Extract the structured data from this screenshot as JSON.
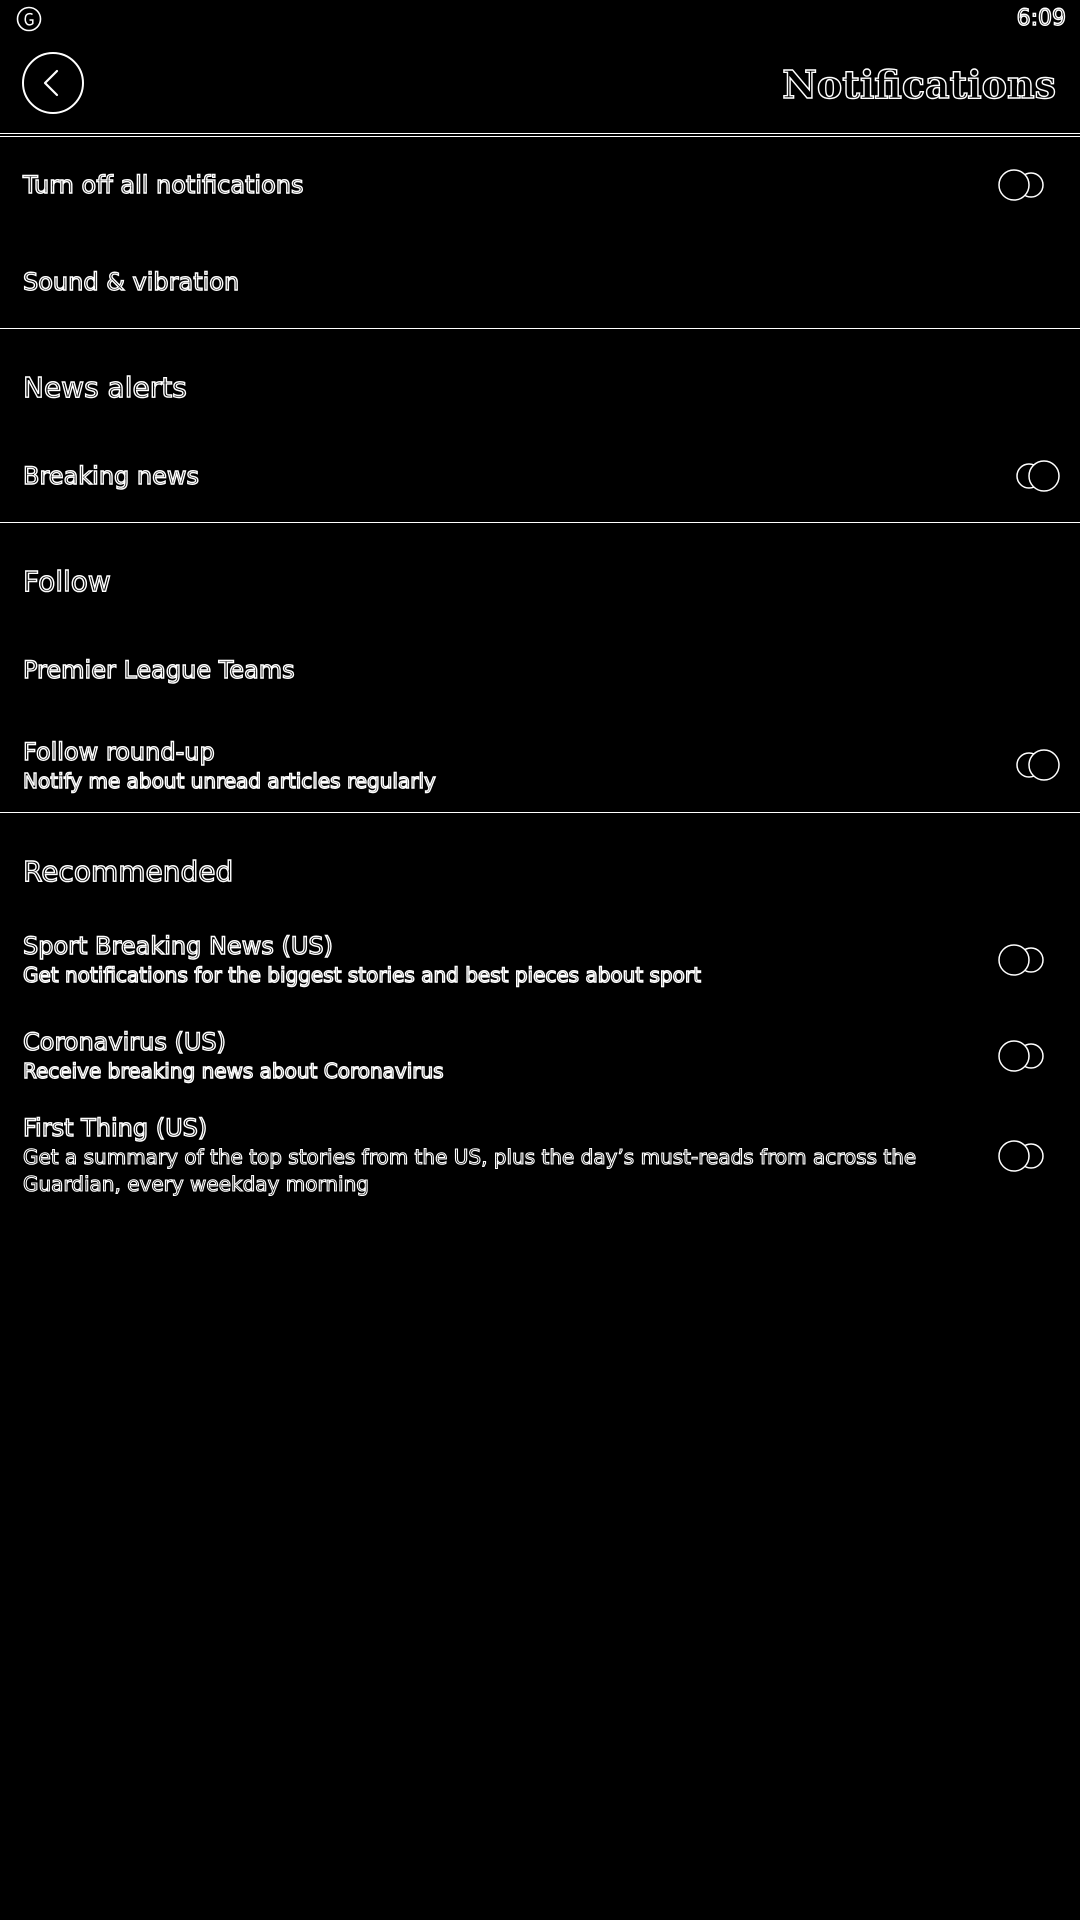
{
  "status_bar": {
    "time": "6:09",
    "app_icon": "guardian-logo-icon"
  },
  "header": {
    "title": "Notifications",
    "back_icon": "chevron-left-icon"
  },
  "general": {
    "turn_off_all": {
      "label": "Turn off all notifications",
      "toggle_on": false
    },
    "sound_vibration": {
      "label": "Sound & vibration"
    }
  },
  "news_alerts": {
    "title": "News alerts",
    "breaking_news": {
      "label": "Breaking news",
      "toggle_on": true
    }
  },
  "follow": {
    "title": "Follow",
    "premier_league": {
      "label": "Premier League Teams"
    },
    "round_up": {
      "label": "Follow round-up",
      "description": "Notify me about unread articles regularly",
      "toggle_on": true
    }
  },
  "recommended": {
    "title": "Recommended",
    "items": [
      {
        "label": "Sport Breaking News (US)",
        "description": "Get notifications for the biggest stories and best pieces about sport",
        "toggle_on": false
      },
      {
        "label": "Coronavirus (US)",
        "description": "Receive breaking news about Coronavirus",
        "toggle_on": false
      },
      {
        "label": "First Thing (US)",
        "description": "Get a summary of the top stories from the US, plus the day’s must-reads from across the Guardian, every weekday morning",
        "toggle_on": false
      }
    ]
  },
  "colors": {
    "background": "#000000",
    "outline": "#ffffff"
  }
}
